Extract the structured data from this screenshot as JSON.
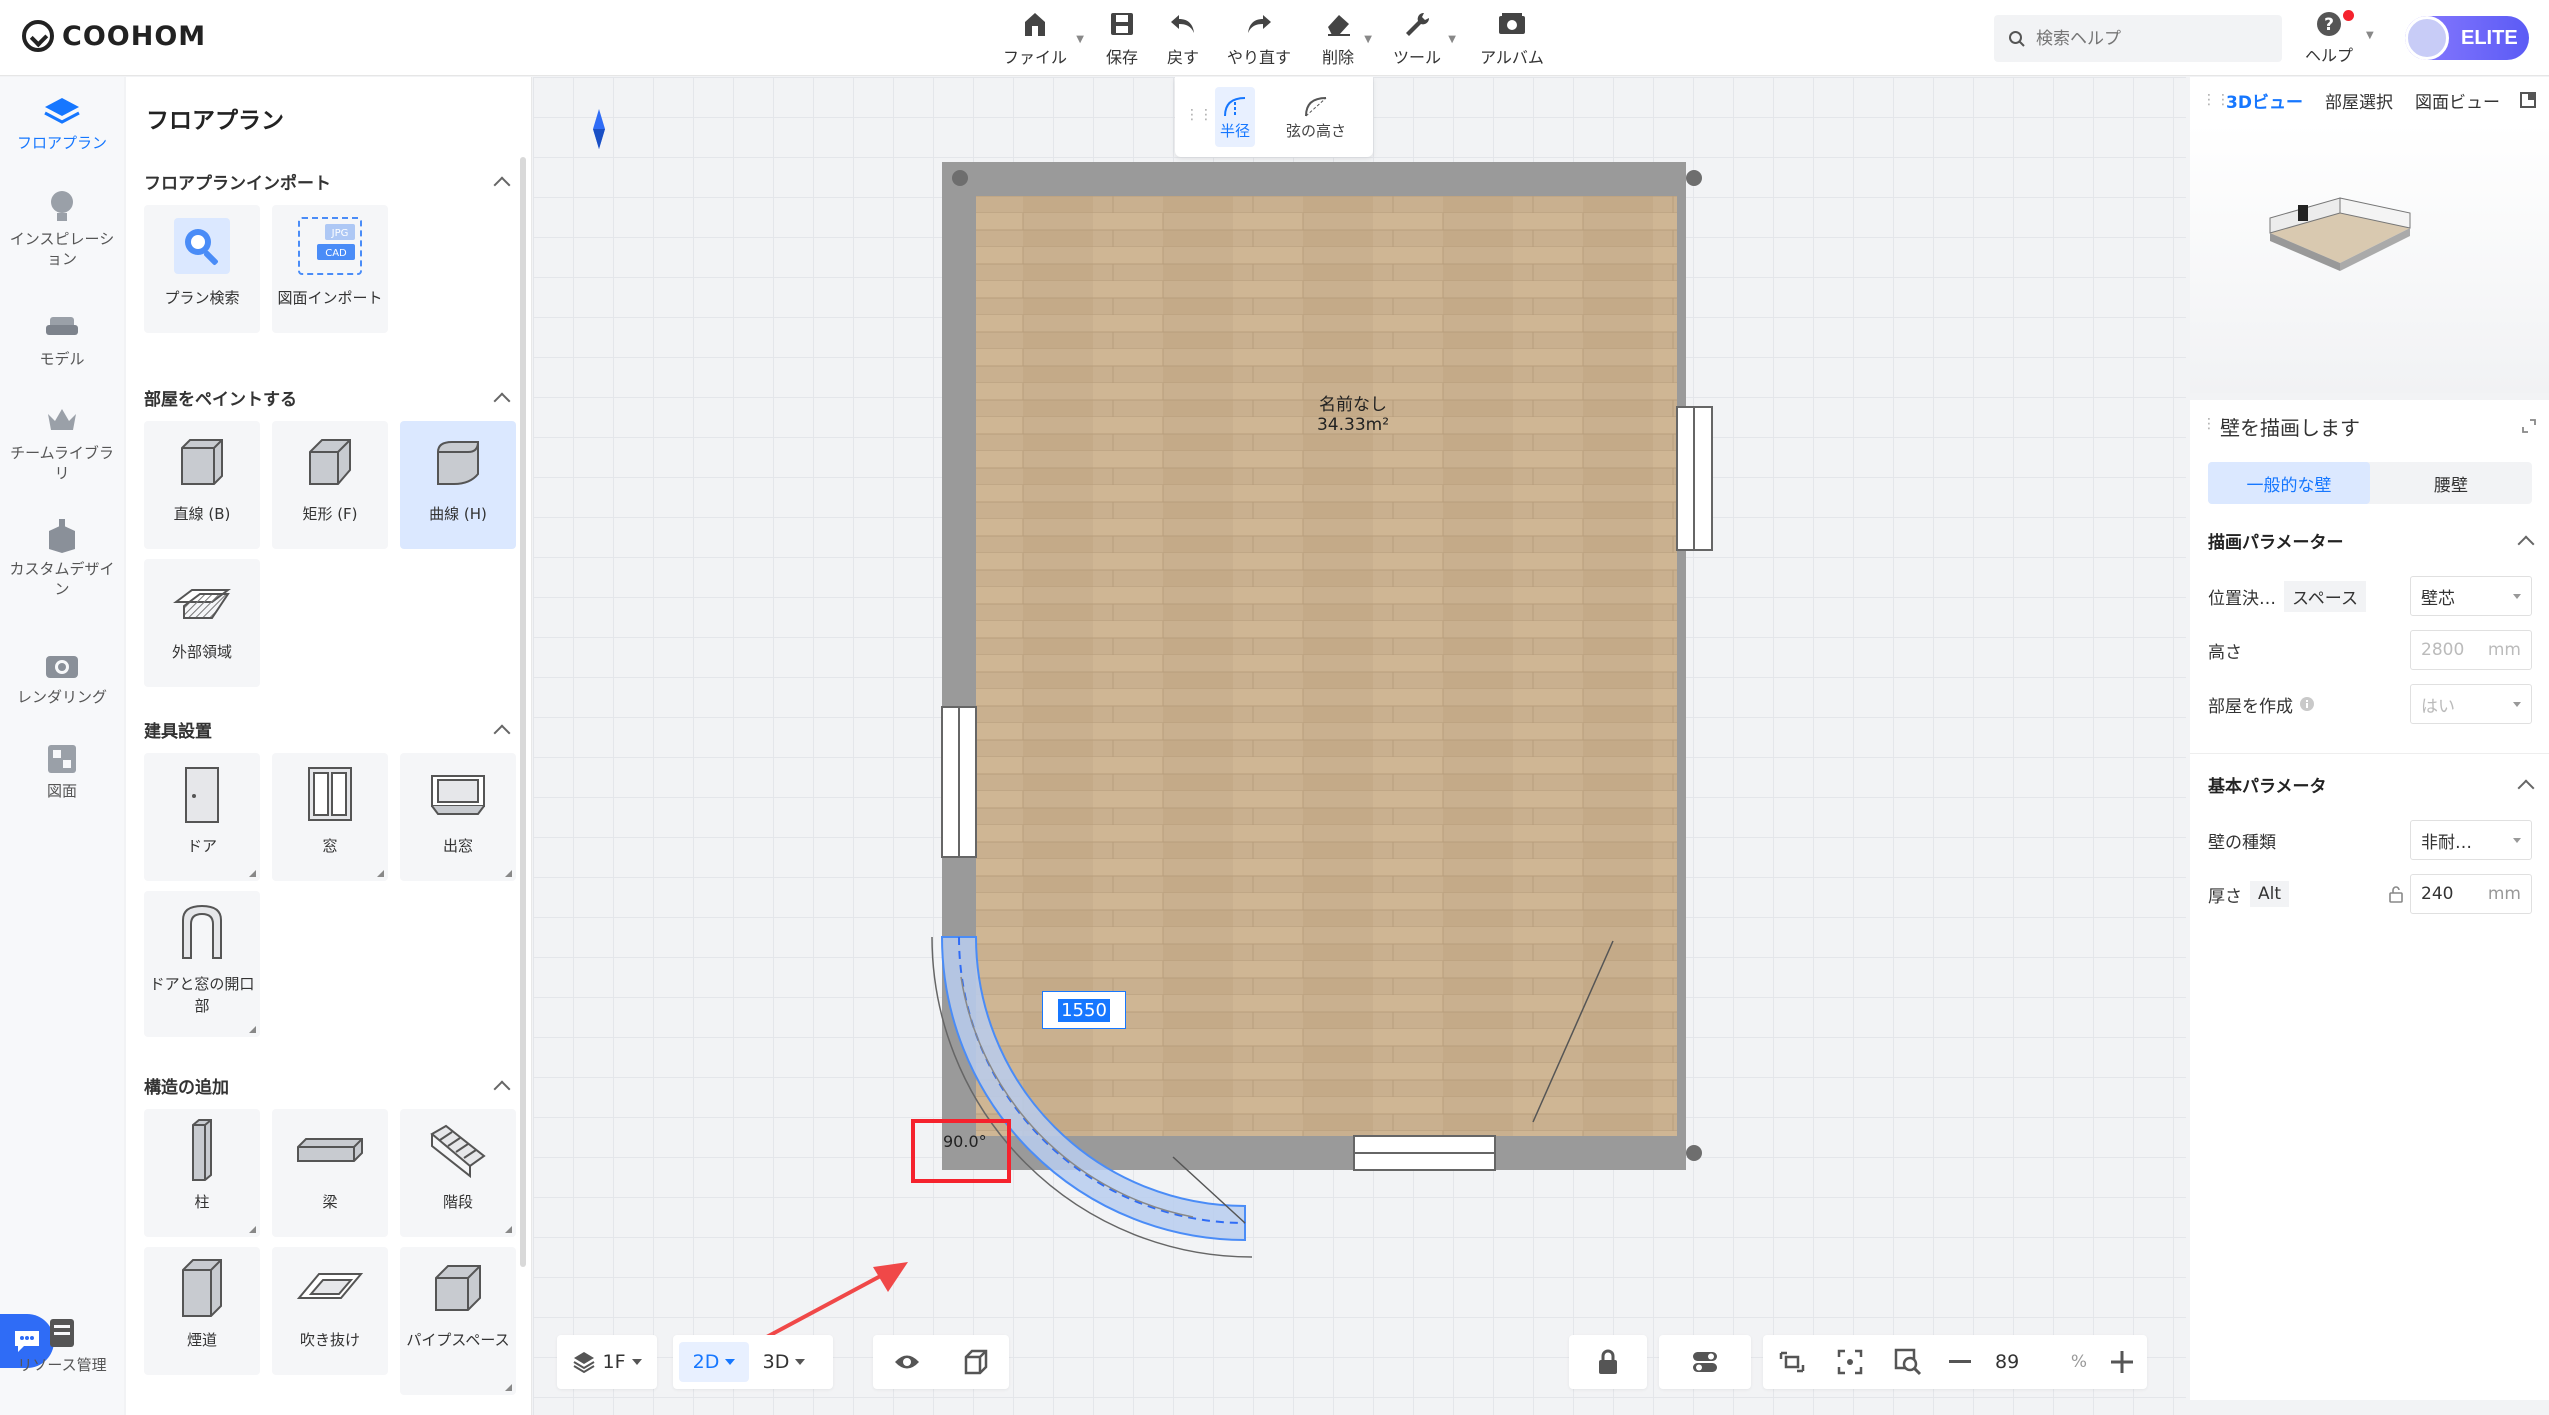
{
  "app": {
    "logo": "COOHOM"
  },
  "toolbar": {
    "file": "ファイル",
    "save": "保存",
    "undo": "戻す",
    "redo": "やり直す",
    "delete": "削除",
    "tools": "ツール",
    "album": "アルバム"
  },
  "search": {
    "placeholder": "検索ヘルプ"
  },
  "help": {
    "label": "ヘルプ"
  },
  "user": {
    "badge": "ELITE"
  },
  "nav": {
    "floorplan": "フロアプラン",
    "inspiration": "インスピレーション",
    "model": "モデル",
    "team": "チームライブラリ",
    "custom": "カスタムデザイン",
    "render": "レンダリング",
    "drawing": "図面",
    "resources": "リソース管理"
  },
  "panel": {
    "title": "フロアプラン",
    "import": {
      "heading": "フロアプランインポート",
      "items": [
        "プラン検索",
        "図面インポート"
      ],
      "badge_jpg": "JPG",
      "badge_cad": "CAD"
    },
    "paint": {
      "heading": "部屋をペイントする",
      "items": [
        "直線 (B)",
        "矩形 (F)",
        "曲線 (H)",
        "外部領域"
      ]
    },
    "fixtures": {
      "heading": "建具設置",
      "items": [
        "ドア",
        "窓",
        "出窓",
        "ドアと窓の開口部"
      ]
    },
    "structure": {
      "heading": "構造の追加",
      "items": [
        "柱",
        "梁",
        "階段",
        "煙道",
        "吹き抜け",
        "パイプスペース"
      ]
    }
  },
  "arc_tools": {
    "radius": "半径",
    "chord": "弦の高さ"
  },
  "canvas": {
    "room_name": "名前なし",
    "room_area": "34.33m²",
    "dimension": "1550",
    "angle": "90.0°"
  },
  "bottom": {
    "floor": "1F",
    "mode_2d": "2D",
    "mode_3d": "3D",
    "zoom": "89",
    "zoom_unit": "%"
  },
  "view3d": {
    "tabs": [
      "3Dビュー",
      "部屋選択",
      "図面ビュー"
    ]
  },
  "props": {
    "title": "壁を描画します",
    "seg": [
      "一般的な壁",
      "腰壁"
    ],
    "drawing_params": "描画パラメーター",
    "position_label": "位置決…",
    "position_tag": "スペース",
    "position_value": "壁芯",
    "height_label": "高さ",
    "height_value": "2800",
    "height_unit": "mm",
    "make_room_label": "部屋を作成",
    "make_room_value": "はい",
    "basic_params": "基本パラメータ",
    "wall_type_label": "壁の種類",
    "wall_type_value": "非耐…",
    "thickness_label": "厚さ",
    "thickness_tag": "Alt",
    "thickness_value": "240",
    "thickness_unit": "mm"
  },
  "colors": {
    "accent": "#1677ff",
    "highlight": "#f5222d",
    "floor": "#c9b08f",
    "wall": "#9a9a9a"
  }
}
